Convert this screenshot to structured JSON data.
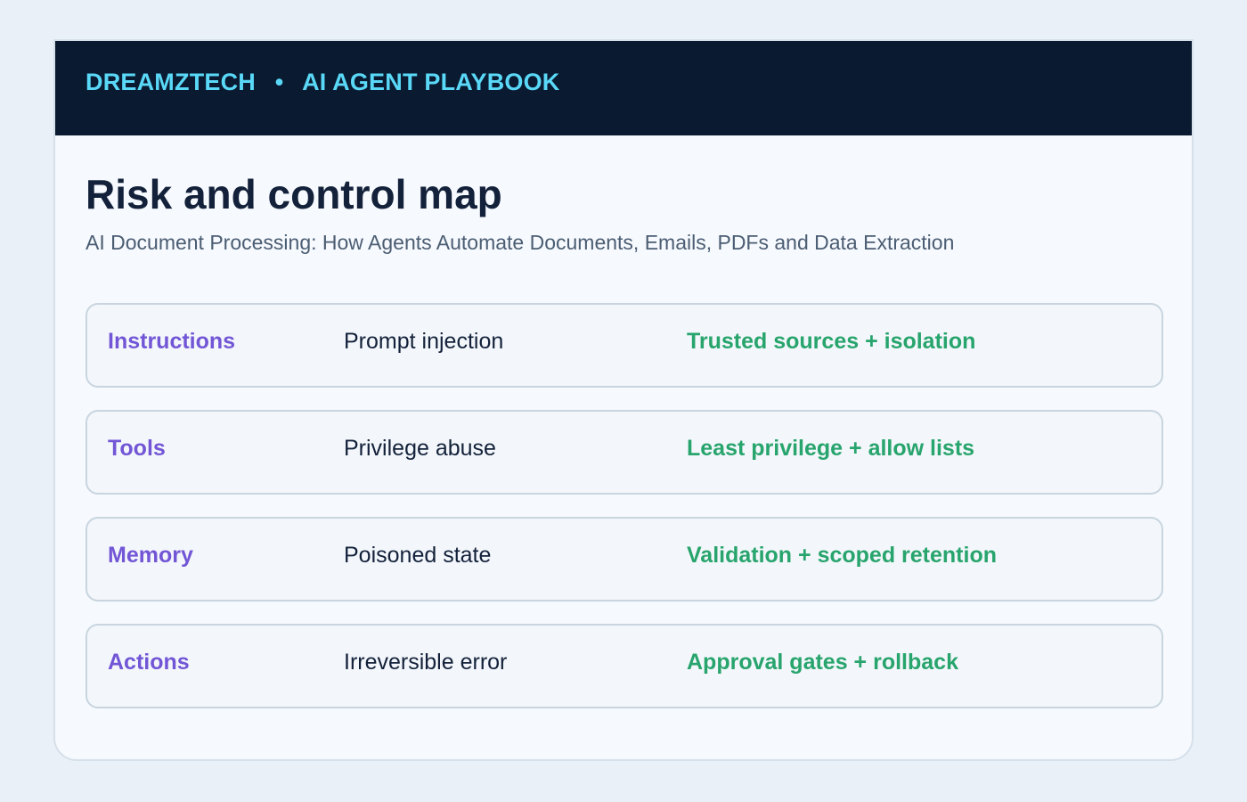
{
  "header": {
    "brand": "DREAMZTECH",
    "separator": "•",
    "section": "AI AGENT PLAYBOOK"
  },
  "main": {
    "title": "Risk and control map",
    "subtitle": "AI Document Processing: How Agents Automate Documents, Emails, PDFs and Data Extraction",
    "rows": [
      {
        "area": "Instructions",
        "risk": "Prompt injection",
        "control": "Trusted sources + isolation"
      },
      {
        "area": "Tools",
        "risk": "Privilege abuse",
        "control": "Least privilege + allow lists"
      },
      {
        "area": "Memory",
        "risk": "Poisoned state",
        "control": "Validation + scoped retention"
      },
      {
        "area": "Actions",
        "risk": "Irreversible error",
        "control": "Approval gates + rollback"
      }
    ]
  },
  "colors": {
    "page_background": "#e9f0f7",
    "header_background": "#0a1a30",
    "brand": "#5ad8f7",
    "area": "#7256d6",
    "control": "#28a46d",
    "text": "#13213a"
  }
}
